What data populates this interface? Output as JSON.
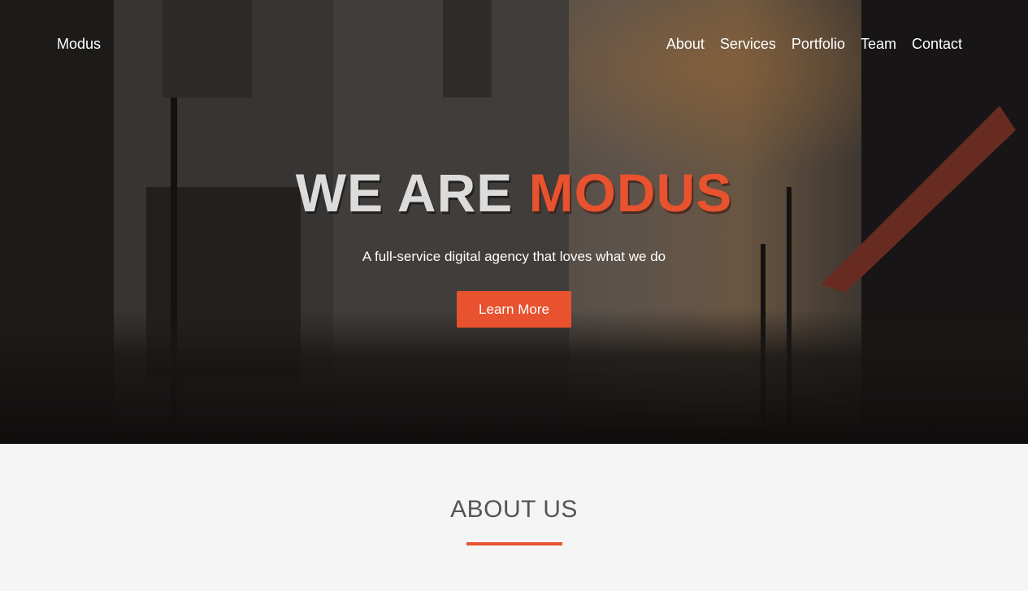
{
  "nav": {
    "brand": "Modus",
    "links": [
      "About",
      "Services",
      "Portfolio",
      "Team",
      "Contact"
    ]
  },
  "hero": {
    "title_part1": "WE ARE",
    "title_part2": "MODUS",
    "subtitle": "A full-service digital agency that loves what we do",
    "cta_label": "Learn More",
    "background": "city-street-crowd-photo"
  },
  "about": {
    "title": "ABOUT US"
  },
  "colors": {
    "accent": "#e8522f",
    "about_bg": "#f5f5f5",
    "heading_gray": "#555555"
  }
}
